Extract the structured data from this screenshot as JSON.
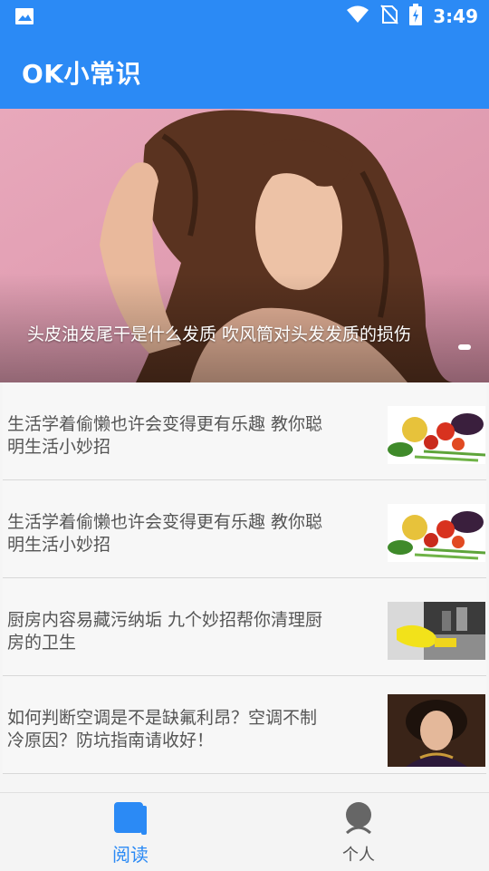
{
  "status_bar": {
    "time": "3:49",
    "icons": [
      "image-icon",
      "wifi-icon",
      "no-sim-icon",
      "battery-charging-icon"
    ]
  },
  "app_bar": {
    "title": "OK小常识"
  },
  "banner": {
    "caption": "头皮油发尾干是什么发质 吹风筒对头发发质的损伤"
  },
  "news": [
    {
      "title": "生活学着偷懒也许会变得更有乐趣 教你聪明生活小妙招",
      "thumb": "vegetables-image"
    },
    {
      "title": "生活学着偷懒也许会变得更有乐趣 教你聪明生活小妙招",
      "thumb": "vegetables-image"
    },
    {
      "title": "厨房内容易藏污纳垢 九个妙招帮你清理厨房的卫生",
      "thumb": "kitchen-cleaning-image"
    },
    {
      "title": "如何判断空调是不是缺氟利昂？空调不制冷原因？防坑指南请收好！",
      "thumb": "woman-portrait-image"
    }
  ],
  "bottom_nav": {
    "tabs": [
      {
        "label": "阅读",
        "icon": "book-icon",
        "active": true
      },
      {
        "label": "个人",
        "icon": "person-icon",
        "active": false
      }
    ]
  },
  "colors": {
    "primary": "#2b8af5",
    "text": "#555555"
  }
}
